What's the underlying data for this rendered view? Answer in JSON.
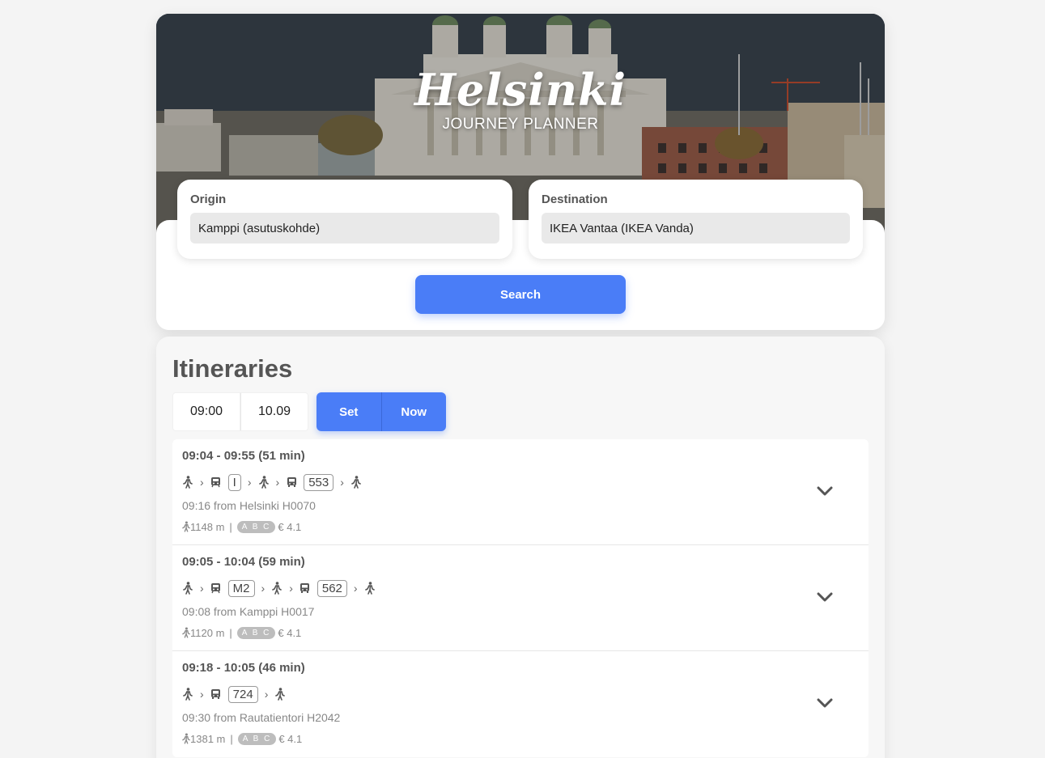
{
  "header": {
    "title": "Helsinki",
    "subtitle": "JOURNEY PLANNER"
  },
  "search": {
    "origin_label": "Origin",
    "origin_value": "Kamppi (asutuskohde)",
    "destination_label": "Destination",
    "destination_value": "IKEA Vantaa (IKEA Vanda)",
    "search_label": "Search"
  },
  "itineraries": {
    "title": "Itineraries",
    "time": "09:00",
    "date": "10.09",
    "set_label": "Set",
    "now_label": "Now",
    "items": [
      {
        "time_range": "09:04 - 09:55 (51 min)",
        "from": "09:16 from Helsinki H0070",
        "walk": "1148 m",
        "zones": "A B C",
        "price": "€ 4.1",
        "lines": [
          "I",
          "553"
        ]
      },
      {
        "time_range": "09:05 - 10:04 (59 min)",
        "from": "09:08 from Kamppi H0017",
        "walk": "1120 m",
        "zones": "A B C",
        "price": "€ 4.1",
        "lines": [
          "M2",
          "562"
        ]
      },
      {
        "time_range": "09:18 - 10:05 (46 min)",
        "from": "09:30 from Rautatientori H2042",
        "walk": "1381 m",
        "zones": "A B C",
        "price": "€ 4.1",
        "lines": [
          "724"
        ]
      }
    ]
  },
  "colors": {
    "accent": "#4a7df7",
    "background": "#f4f4f4"
  },
  "icons": {
    "walk": "walk-icon",
    "train": "train-icon",
    "bus": "bus-icon",
    "metro": "metro-icon",
    "expand": "chevron-down-icon"
  }
}
